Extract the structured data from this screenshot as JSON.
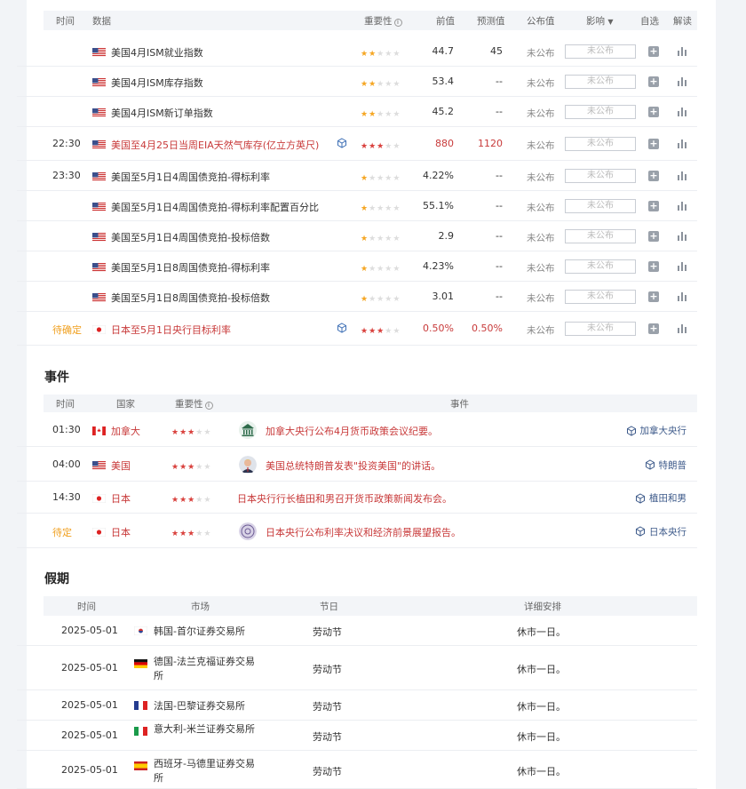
{
  "data_table": {
    "headers": {
      "time": "时间",
      "data": "数据",
      "importance": "重要性",
      "prev": "前值",
      "forecast": "预测值",
      "actual": "公布值",
      "impact": "影响",
      "watch": "自选",
      "interpret": "解读"
    },
    "pub_label": "未公布",
    "unpub_label": "未公布",
    "rows": [
      {
        "time": "",
        "flag": "us",
        "name": "美国4月ISM就业指数",
        "stars": 2,
        "prev": "44.7",
        "forecast": "45",
        "actual": "未公布",
        "hl": false,
        "cube": false
      },
      {
        "time": "",
        "flag": "us",
        "name": "美国4月ISM库存指数",
        "stars": 2,
        "prev": "53.4",
        "forecast": "--",
        "actual": "未公布",
        "hl": false,
        "cube": false
      },
      {
        "time": "",
        "flag": "us",
        "name": "美国4月ISM新订单指数",
        "stars": 2,
        "prev": "45.2",
        "forecast": "--",
        "actual": "未公布",
        "hl": false,
        "cube": false
      },
      {
        "time": "22:30",
        "flag": "us",
        "name": "美国至4月25日当周EIA天然气库存(亿立方英尺)",
        "stars": 3,
        "prev": "880",
        "forecast": "1120",
        "actual": "未公布",
        "hl": true,
        "cube": true
      },
      {
        "time": "23:30",
        "flag": "us",
        "name": "美国至5月1日4周国债竞拍-得标利率",
        "stars": 1,
        "prev": "4.22%",
        "forecast": "--",
        "actual": "未公布",
        "hl": false,
        "cube": false
      },
      {
        "time": "",
        "flag": "us",
        "name": "美国至5月1日4周国债竞拍-得标利率配置百分比",
        "stars": 1,
        "prev": "55.1%",
        "forecast": "--",
        "actual": "未公布",
        "hl": false,
        "cube": false
      },
      {
        "time": "",
        "flag": "us",
        "name": "美国至5月1日4周国债竞拍-投标倍数",
        "stars": 1,
        "prev": "2.9",
        "forecast": "--",
        "actual": "未公布",
        "hl": false,
        "cube": false
      },
      {
        "time": "",
        "flag": "us",
        "name": "美国至5月1日8周国债竞拍-得标利率",
        "stars": 1,
        "prev": "4.23%",
        "forecast": "--",
        "actual": "未公布",
        "hl": false,
        "cube": false
      },
      {
        "time": "",
        "flag": "us",
        "name": "美国至5月1日8周国债竞拍-投标倍数",
        "stars": 1,
        "prev": "3.01",
        "forecast": "--",
        "actual": "未公布",
        "hl": false,
        "cube": false
      },
      {
        "time": "待确定",
        "flag": "jp",
        "name": "日本至5月1日央行目标利率",
        "stars": 3,
        "prev": "0.50%",
        "forecast": "0.50%",
        "actual": "未公布",
        "hl": true,
        "cube": true
      }
    ]
  },
  "events": {
    "title": "事件",
    "headers": {
      "time": "时间",
      "country": "国家",
      "importance": "重要性",
      "event": "事件"
    },
    "rows": [
      {
        "time": "01:30",
        "flag": "ca",
        "country": "加拿大",
        "stars": 3,
        "avatar": "bank",
        "text": "加拿大央行公布4月货币政策会议纪要。",
        "link": "加拿大央行",
        "pending": false
      },
      {
        "time": "04:00",
        "flag": "us",
        "country": "美国",
        "stars": 3,
        "avatar": "person",
        "text": "美国总统特朗普发表\"投资美国\"的讲话。",
        "link": "特朗普",
        "pending": false
      },
      {
        "time": "14:30",
        "flag": "jp",
        "country": "日本",
        "stars": 3,
        "avatar": "",
        "text": "日本央行行长植田和男召开货币政策新闻发布会。",
        "link": "植田和男",
        "pending": false
      },
      {
        "time": "待定",
        "flag": "jp",
        "country": "日本",
        "stars": 3,
        "avatar": "seal",
        "text": "日本央行公布利率决议和经济前景展望报告。",
        "link": "日本央行",
        "pending": true
      }
    ]
  },
  "holidays": {
    "title": "假期",
    "headers": {
      "time": "时间",
      "market": "市场",
      "festival": "节日",
      "detail": "详细安排"
    },
    "rows": [
      {
        "date": "2025-05-01",
        "flag": "kr",
        "market": "韩国-首尔证券交易所",
        "festival": "劳动节",
        "detail": "休市一日。"
      },
      {
        "date": "2025-05-01",
        "flag": "de",
        "market": "德国-法兰克福证券交易所",
        "festival": "劳动节",
        "detail": "休市一日。"
      },
      {
        "date": "2025-05-01",
        "flag": "fr",
        "market": "法国-巴黎证券交易所",
        "festival": "劳动节",
        "detail": "休市一日。"
      },
      {
        "date": "2025-05-01",
        "flag": "it",
        "market": "意大利-米兰证券交易所",
        "festival": "劳动节",
        "detail": "休市一日。"
      },
      {
        "date": "2025-05-01",
        "flag": "es",
        "market": "西班牙-马德里证券交易所",
        "festival": "劳动节",
        "detail": "休市一日。"
      }
    ]
  },
  "colors": {
    "highlight": "#c83a3a",
    "pending": "#f0a020",
    "star": "#f5a623",
    "link": "#3d5a8a"
  }
}
